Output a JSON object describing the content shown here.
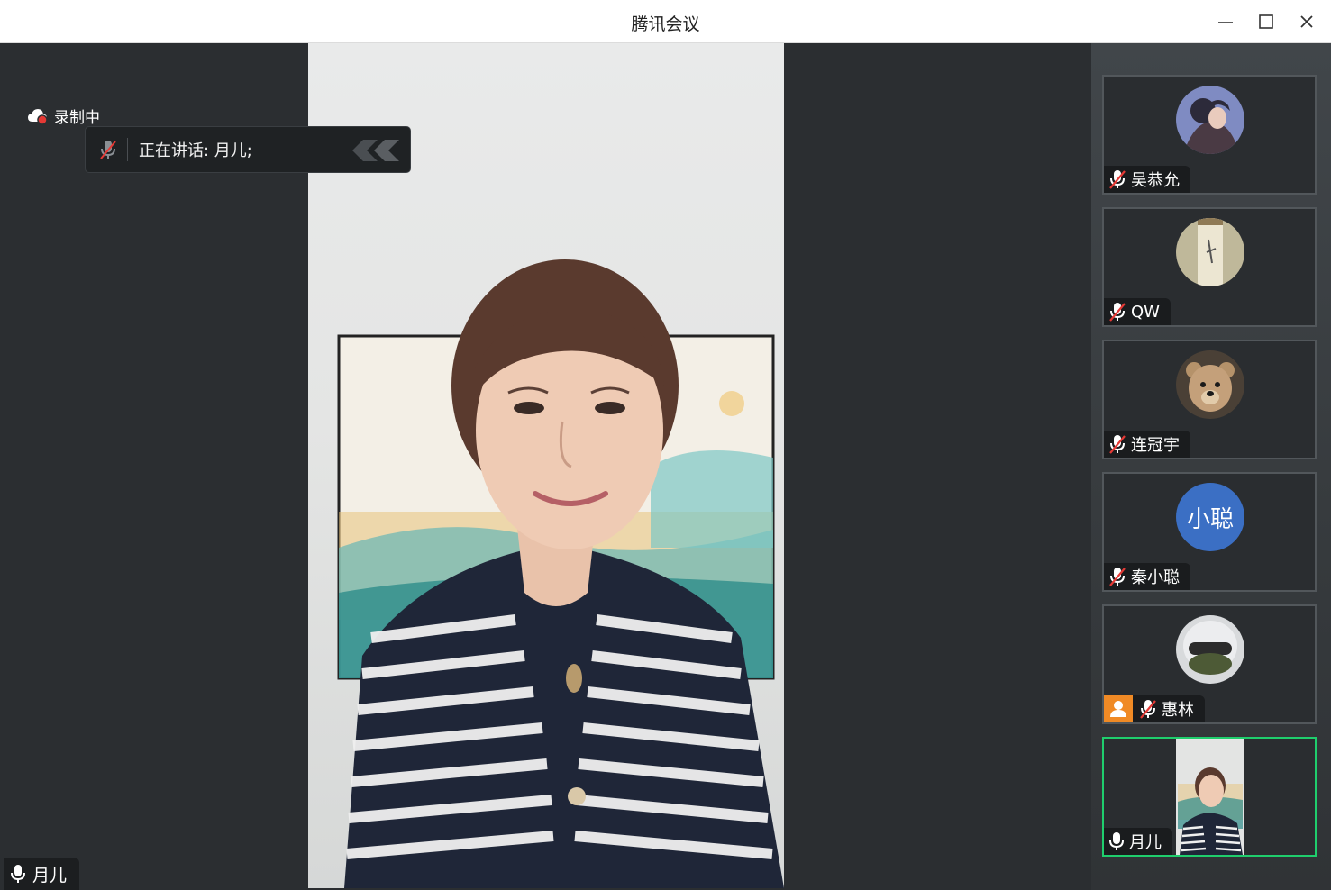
{
  "window": {
    "title": "腾讯会议"
  },
  "recording": {
    "label": "录制中"
  },
  "speaking": {
    "label": "正在讲话:  月儿;"
  },
  "self": {
    "name": "月儿"
  },
  "participants": [
    {
      "name": "吴恭允",
      "avatar": "photo-anime",
      "muted": true,
      "host": false
    },
    {
      "name": "QW",
      "avatar": "photo-scroll",
      "muted": true,
      "host": false
    },
    {
      "name": "连冠宇",
      "avatar": "photo-teddy-bear",
      "muted": true,
      "host": false
    },
    {
      "name": "秦小聪",
      "avatar_text": "小聪",
      "avatar_color": "#3b6fc4",
      "muted": true,
      "host": false
    },
    {
      "name": "惠林",
      "avatar": "photo-helmet",
      "muted": true,
      "host": true
    },
    {
      "name": "月儿",
      "avatar": "video-thumbnail",
      "muted": false,
      "host": false,
      "active": true
    }
  ],
  "colors": {
    "active_border": "#1fce6d",
    "host_badge": "#f08a25",
    "muted_slash": "#e53935",
    "rec_dot": "#e53935"
  }
}
